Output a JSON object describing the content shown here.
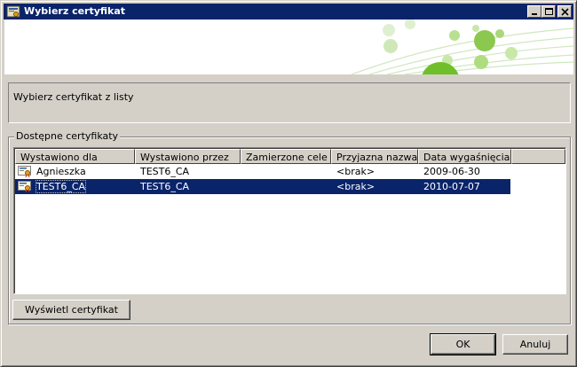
{
  "window": {
    "title": "Wybierz certyfikat"
  },
  "icons": {
    "app": "certificate-app-icon",
    "row": "certificate-icon",
    "minimize": "minimize-icon",
    "maximize": "maximize-icon",
    "close": "close-icon"
  },
  "info": {
    "text": "Wybierz certyfikat z listy"
  },
  "group": {
    "label": "Dostępne certyfikaty"
  },
  "table": {
    "columns": [
      "Wystawiono dla",
      "Wystawiono przez",
      "Zamierzone cele",
      "Przyjazna nazwa",
      "Data wygaśnięcia"
    ],
    "rows": [
      {
        "issued_to": "Agnieszka",
        "issued_by": "TEST6_CA",
        "purposes": "",
        "friendly": "<brak>",
        "expires": "2009-06-30",
        "selected": false
      },
      {
        "issued_to": "TEST6_CA",
        "issued_by": "TEST6_CA",
        "purposes": "",
        "friendly": "<brak>",
        "expires": "2010-07-07",
        "selected": true
      }
    ]
  },
  "buttons": {
    "view": "Wyświetl certyfikat",
    "ok": "OK",
    "cancel": "Anuluj"
  },
  "colors": {
    "title_bar": "#0a246a",
    "selection": "#0a246a",
    "face": "#d4d0c8",
    "banner_green": "#6fbf2a"
  }
}
